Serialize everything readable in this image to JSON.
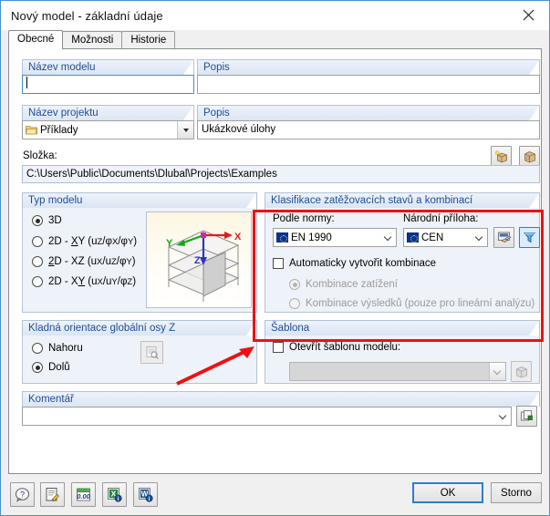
{
  "window": {
    "title": "Nový model - základní údaje",
    "close_icon": "close-icon"
  },
  "tabs": [
    {
      "label": "Obecné",
      "active": true
    },
    {
      "label": "Možnosti",
      "active": false
    },
    {
      "label": "Historie",
      "active": false
    }
  ],
  "model_name": {
    "caption": "Název modelu",
    "value": "",
    "focused": true
  },
  "model_description": {
    "caption": "Popis",
    "value": ""
  },
  "project_name": {
    "caption": "Název projektu",
    "value": "Příklady",
    "icon": "folder-icon"
  },
  "project_description": {
    "caption": "Popis",
    "value": "Ukázkové úlohy"
  },
  "project_buttons": [
    {
      "name": "new-project-button",
      "icon": "new-box-icon"
    },
    {
      "name": "open-project-button",
      "icon": "open-box-icon"
    }
  ],
  "folder": {
    "caption": "Složka:",
    "path": "C:\\Users\\Public\\Documents\\Dlubal\\Projects\\Examples"
  },
  "model_type": {
    "title": "Typ modelu",
    "options": [
      {
        "label": "3D",
        "selected": true
      },
      {
        "label": "2D - XY (uZ/φX/φY)",
        "selected": false
      },
      {
        "label": "2D - XZ (uX/uZ/φY)",
        "selected": false
      },
      {
        "label": "2D - XY (uX/uY/φZ)",
        "selected": false
      }
    ],
    "preview_icon": "model-preview-3d",
    "axes": {
      "x": "X",
      "y": "Y",
      "z": "Z"
    }
  },
  "classification": {
    "title": "Klasifikace zatěžovacích stavů a kombinací",
    "standard_caption": "Podle normy:",
    "standard_value": "EN 1990",
    "annex_caption": "Národní příloha:",
    "annex_value": "CEN",
    "settings_button_icon": "settings-icon",
    "filter_button_icon": "filter-funnel-icon",
    "auto_combinations": {
      "label": "Automaticky vytvořit kombinace",
      "checked": false
    },
    "sub_options": [
      {
        "label": "Kombinace zatížení",
        "selected": true,
        "disabled": true
      },
      {
        "label": "Kombinace výsledků (pouze pro lineární analýzu)",
        "selected": false,
        "disabled": true
      }
    ]
  },
  "z_orientation": {
    "title": "Kladná orientace globální osy Z",
    "options": [
      {
        "label": "Nahoru",
        "selected": false
      },
      {
        "label": "Dolů",
        "selected": true
      }
    ],
    "preview_button_icon": "preview-magnifier-icon"
  },
  "template": {
    "title": "Šablona",
    "checkbox_label": "Otevřít šablonu modelu:",
    "checked": false,
    "combo_value": "",
    "browse_button_icon": "open-box-icon"
  },
  "comment": {
    "caption": "Komentář",
    "value": "",
    "button_icon": "copy-icon"
  },
  "toolbar": [
    {
      "name": "help-button",
      "icon": "question-balloon-icon"
    },
    {
      "name": "edit-button",
      "icon": "notepad-pencil-icon"
    },
    {
      "name": "units-button",
      "icon": "units-000-icon",
      "label": "0.00"
    },
    {
      "name": "excel-export-button",
      "icon": "excel-icon"
    },
    {
      "name": "word-export-button",
      "icon": "word-icon"
    }
  ],
  "dialog_buttons": {
    "ok": "OK",
    "cancel": "Storno"
  },
  "annotation": {
    "box_color": "#ee1111",
    "arrow_color": "#ee1111"
  }
}
